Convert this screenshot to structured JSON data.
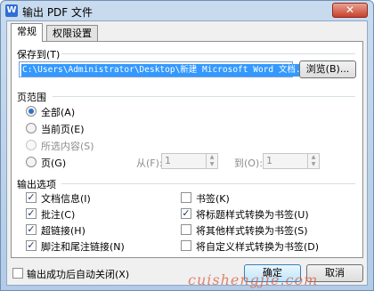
{
  "window": {
    "title": "输出 PDF 文件",
    "app_icon_letter": "W",
    "close_glyph": "✕"
  },
  "tabs": [
    {
      "label": "常规"
    },
    {
      "label": "权限设置"
    }
  ],
  "save_to": {
    "label": "保存到(T)",
    "path_value": "C:\\Users\\Administrator\\Desktop\\新建 Microsoft Word 文档.pdf",
    "browse_button": "浏览(B)..."
  },
  "page_range": {
    "label": "页范围",
    "options": [
      {
        "label": "全部(A)",
        "selected": true,
        "disabled": false
      },
      {
        "label": "当前页(E)",
        "selected": false,
        "disabled": false
      },
      {
        "label": "所选内容(S)",
        "selected": false,
        "disabled": true
      },
      {
        "label": "页(G)",
        "selected": false,
        "disabled": false
      }
    ],
    "from_label": "从(F):",
    "from_value": "1",
    "to_label": "到(O):",
    "to_value": "1"
  },
  "output_options": {
    "label": "输出选项",
    "left": [
      {
        "label": "文档信息(I)",
        "checked": true
      },
      {
        "label": "批注(C)",
        "checked": true
      },
      {
        "label": "超链接(H)",
        "checked": true
      },
      {
        "label": "脚注和尾注链接(N)",
        "checked": true
      }
    ],
    "right": [
      {
        "label": "书签(K)",
        "checked": false
      },
      {
        "label": "将标题样式转换为书签(U)",
        "checked": true
      },
      {
        "label": "将其他样式转换为书签(S)",
        "checked": false
      },
      {
        "label": "将自定义样式转换为书签(D)",
        "checked": false
      }
    ]
  },
  "footer": {
    "auto_close_label": "输出成功后自动关闭(X)",
    "auto_close_checked": false,
    "ok_button": "确定",
    "cancel_button": "取消"
  },
  "watermark": "cuishengjie.com",
  "check_glyph": "✓",
  "spin_up": "▲",
  "spin_down": "▼",
  "colors": {
    "selection": "#3399ff",
    "accent": "#2d74c5"
  }
}
